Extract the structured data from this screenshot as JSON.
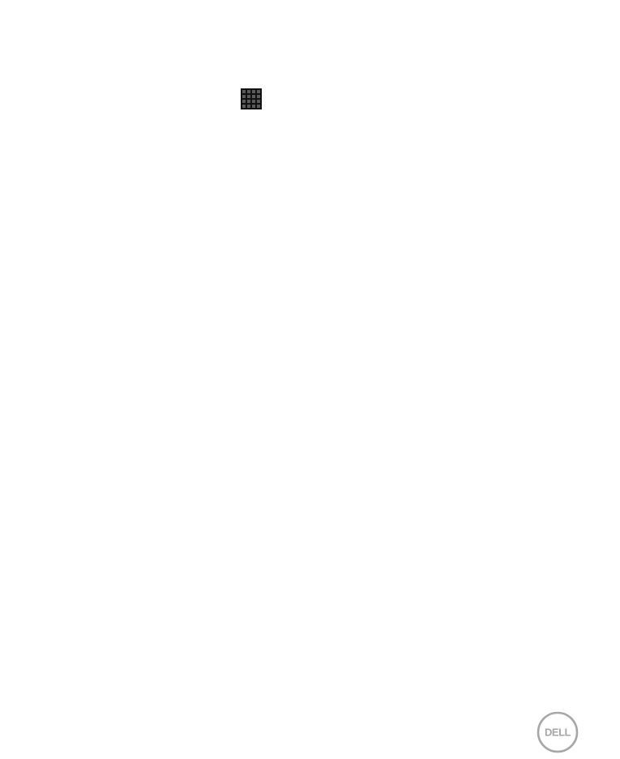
{
  "icons": {
    "apps": "apps-grid-icon"
  },
  "logo": {
    "brand_text": "DELL",
    "color": "#a6a6a6"
  },
  "colors": {
    "background": "#ffffff",
    "icon_background": "#111111",
    "icon_cell": "#5a5a5a"
  }
}
